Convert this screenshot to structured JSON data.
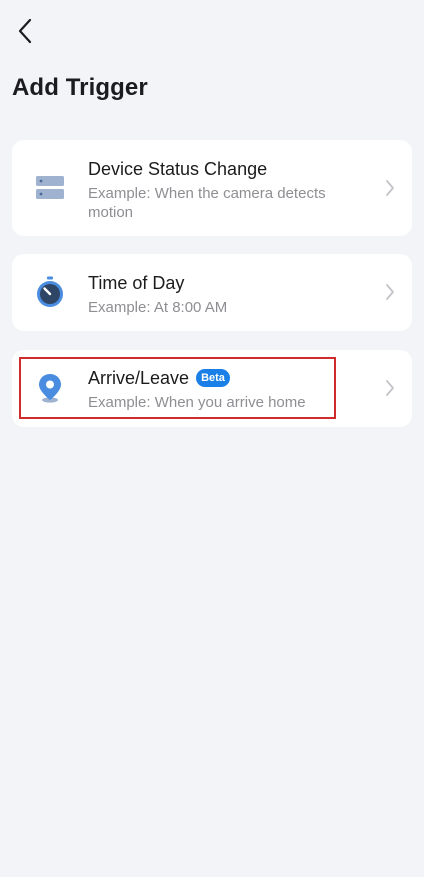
{
  "header": {
    "back_icon": "chevron-left-icon",
    "title": "Add Trigger"
  },
  "triggers": [
    {
      "title": "Device Status Change",
      "subtitle": "Example: When the camera detects motion",
      "icon": "device-status-icon"
    },
    {
      "title": "Time of Day",
      "subtitle": "Example: At 8:00 AM",
      "icon": "timer-icon"
    },
    {
      "title": "Arrive/Leave",
      "badge": "Beta",
      "subtitle": "Example: When you arrive home",
      "icon": "location-pin-icon",
      "highlighted": true
    }
  ],
  "colors": {
    "background": "#f3f4f8",
    "card": "#ffffff",
    "icon_blue": "#4a8de0",
    "icon_gray_blue": "#9fb3d1",
    "badge": "#1a7fe6",
    "highlight": "#d12c2c",
    "subtitle": "#8e8e93"
  }
}
